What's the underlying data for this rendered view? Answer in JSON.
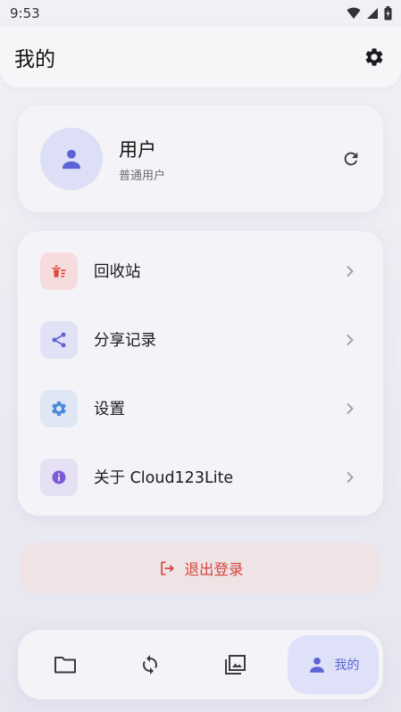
{
  "status_bar": {
    "time": "9:53"
  },
  "header": {
    "title": "我的"
  },
  "profile": {
    "name": "用户",
    "role": "普通用户"
  },
  "menu": [
    {
      "label": "回收站",
      "icon": "trash-icon",
      "icon_color": "#e0453e",
      "icon_bg": "#f6dcdc"
    },
    {
      "label": "分享记录",
      "icon": "share-icon",
      "icon_color": "#5b63d6",
      "icon_bg": "#e1e2f5"
    },
    {
      "label": "设置",
      "icon": "gear-icon",
      "icon_color": "#4a8ad8",
      "icon_bg": "#dfe6f4"
    },
    {
      "label": "关于 Cloud123Lite",
      "icon": "info-icon",
      "icon_color": "#7b5bd6",
      "icon_bg": "#e5e0f4"
    }
  ],
  "logout": {
    "label": "退出登录"
  },
  "bottom_nav": {
    "items": [
      {
        "icon": "folder-icon"
      },
      {
        "icon": "sync-icon"
      },
      {
        "icon": "gallery-icon"
      },
      {
        "icon": "person-icon",
        "label": "我的",
        "active": true
      }
    ]
  },
  "colors": {
    "accent": "#5b63d6",
    "danger": "#d6453d"
  }
}
